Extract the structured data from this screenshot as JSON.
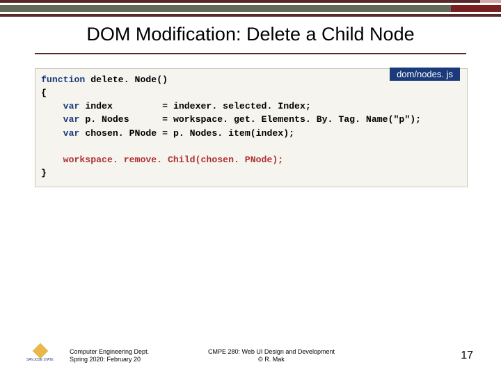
{
  "title": "DOM Modification: Delete a Child Node",
  "file_badge": "dom/nodes. js",
  "code": {
    "l1_kw": "function",
    "l1_rest": " delete. Node()",
    "l2": "{",
    "l3_kw": "    var",
    "l3_rest": " index         = indexer. selected. Index;",
    "l4_kw": "    var",
    "l4_rest": " p. Nodes      = workspace. get. Elements. By. Tag. Name(\"p\");",
    "l5_kw": "    var",
    "l5_rest": " chosen. PNode = p. Nodes. item(index);",
    "l6": "",
    "l7": "    workspace. remove. Child(chosen. PNode);",
    "l8": "}"
  },
  "footer": {
    "logo_text": "SAN JOSE STATE",
    "dept_line1": "Computer Engineering Dept.",
    "dept_line2": "Spring 2020: February 20",
    "course_line1": "CMPE 280: Web UI Design and Development",
    "course_line2": "© R. Mak",
    "page_number": "17"
  }
}
